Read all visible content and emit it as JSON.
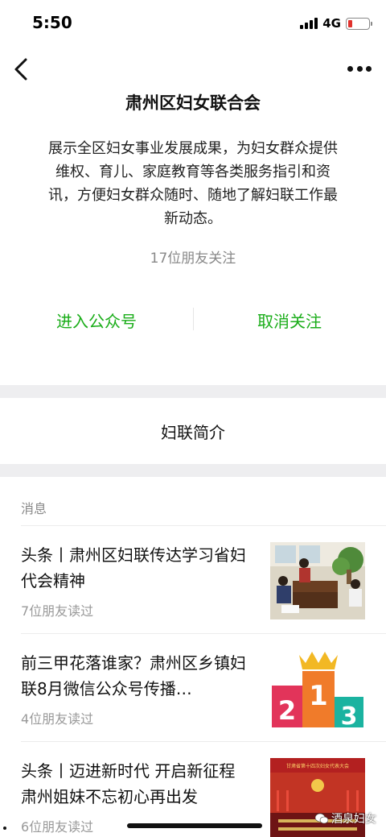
{
  "status_bar": {
    "time": "5:50",
    "network": "4G"
  },
  "header": {
    "account_name": "肃州区妇女联合会",
    "description": "展示全区妇女事业发展成果，为妇女群众提供维权、育儿、家庭教育等各类服务指引和资讯，方便妇女群众随时、随地了解妇联工作最新动态。",
    "follow_count": "17位朋友关注"
  },
  "actions": {
    "enter": "进入公众号",
    "unfollow": "取消关注"
  },
  "intro_label": "妇联简介",
  "messages": {
    "section_label": "消息",
    "items": [
      {
        "title": "头条丨肃州区妇联传达学习省妇代会精神",
        "reads": "7位朋友读过"
      },
      {
        "title": "前三甲花落谁家？肃州区乡镇妇联8月微信公众号传播…",
        "reads": "4位朋友读过"
      },
      {
        "title": "头条丨迈进新时代  开启新征程  肃州姐妹不忘初心再出发",
        "reads": "6位朋友读过"
      }
    ]
  },
  "thumb3_banner": "甘肃省第十四次妇女代表大会",
  "watermark": "酒泉妇女",
  "colors": {
    "accent_green": "#1aad19",
    "battery_low": "#e0312c"
  }
}
